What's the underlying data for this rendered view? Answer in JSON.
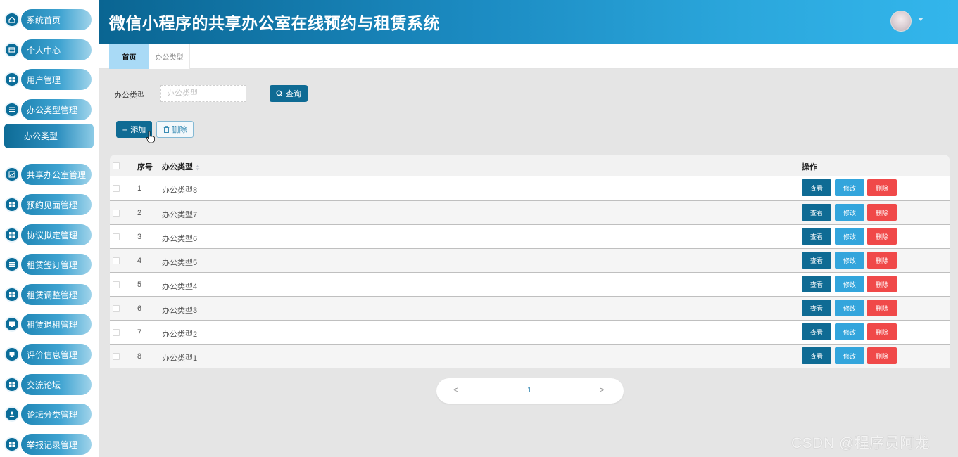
{
  "app": {
    "title": "微信小程序的共享办公室在线预约与租赁系统"
  },
  "sidebar": {
    "items": [
      {
        "label": "系统首页",
        "icon": "home-icon"
      },
      {
        "label": "个人中心",
        "icon": "card-icon"
      },
      {
        "label": "用户管理",
        "icon": "grid-icon"
      },
      {
        "label": "办公类型管理",
        "icon": "list-icon"
      },
      {
        "label": "共享办公室管理",
        "icon": "chart-icon"
      },
      {
        "label": "预约见面管理",
        "icon": "grid-icon"
      },
      {
        "label": "协议拟定管理",
        "icon": "grid-icon"
      },
      {
        "label": "租赁签订管理",
        "icon": "table-icon"
      },
      {
        "label": "租赁调整管理",
        "icon": "grid-icon"
      },
      {
        "label": "租赁退租管理",
        "icon": "monitor-icon"
      },
      {
        "label": "评价信息管理",
        "icon": "chat-icon"
      },
      {
        "label": "交流论坛",
        "icon": "grid-icon"
      },
      {
        "label": "论坛分类管理",
        "icon": "user-icon"
      },
      {
        "label": "举报记录管理",
        "icon": "grid-icon"
      }
    ],
    "active_sub": "办公类型"
  },
  "tabs": [
    {
      "label": "首页"
    },
    {
      "label": "办公类型"
    }
  ],
  "search": {
    "label": "办公类型",
    "placeholder": "办公类型",
    "value": "",
    "button": "查询"
  },
  "toolbar": {
    "add": "添加",
    "delete": "删除"
  },
  "table": {
    "headers": {
      "index": "序号",
      "type": "办公类型",
      "actions": "操作"
    },
    "rows": [
      {
        "index": "1",
        "type": "办公类型8"
      },
      {
        "index": "2",
        "type": "办公类型7"
      },
      {
        "index": "3",
        "type": "办公类型6"
      },
      {
        "index": "4",
        "type": "办公类型5"
      },
      {
        "index": "5",
        "type": "办公类型4"
      },
      {
        "index": "6",
        "type": "办公类型3"
      },
      {
        "index": "7",
        "type": "办公类型2"
      },
      {
        "index": "8",
        "type": "办公类型1"
      }
    ],
    "actions": {
      "view": "查看",
      "edit": "修改",
      "delete": "删除"
    }
  },
  "pagination": {
    "prev": "<",
    "current": "1",
    "next": ">"
  },
  "watermark": "CSDN @程序员阿龙",
  "colors": {
    "primary": "#0f6b94",
    "edit": "#33a5dc",
    "danger": "#f04949",
    "tab_active": "#a9daf6"
  }
}
